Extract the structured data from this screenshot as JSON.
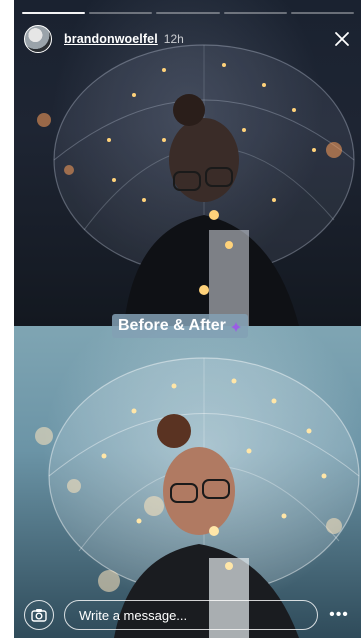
{
  "story": {
    "progress_segments": 5,
    "progress_completed": 1,
    "user": {
      "username": "brandonwoelfel",
      "time": "12h"
    },
    "caption": "Before & After",
    "composer": {
      "placeholder": "Write a message..."
    },
    "icons": {
      "close": "close-icon",
      "camera": "camera-icon",
      "more": "more-icon",
      "caption_sticker": "sparkle-icon"
    },
    "colors": {
      "caption_bg": "#82a0b4",
      "caption_icon": "#9b5de5",
      "progress_active": "#ffffff"
    }
  }
}
